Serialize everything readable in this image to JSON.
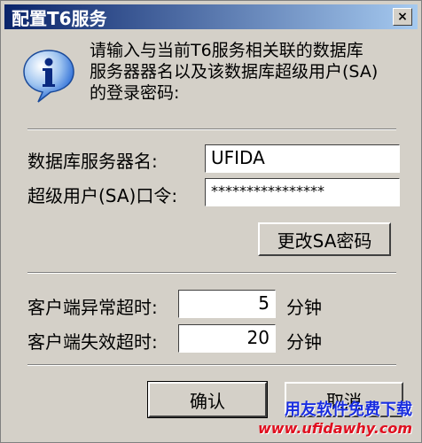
{
  "window": {
    "title": "配置T6服务",
    "close_glyph": "×"
  },
  "description": {
    "line1": "请输入与当前T6服务相关联的数据库",
    "line2": "服务器器名以及该数据库超级用户(SA)",
    "line3": "的登录密码:"
  },
  "db_server": {
    "label": "数据库服务器名:",
    "value": "UFIDA"
  },
  "sa_password": {
    "label": "超级用户(SA)口令:",
    "value": "****************"
  },
  "change_sa_button": "更改SA密码",
  "timeouts": {
    "exception_label": "客户端异常超时:",
    "exception_value": "5",
    "exception_unit": "分钟",
    "invalid_label": "客户端失效超时:",
    "invalid_value": "20",
    "invalid_unit": "分钟"
  },
  "buttons": {
    "ok": "确认",
    "cancel": "取消"
  },
  "watermark": {
    "cn": "用友软件免费下载",
    "url": "www.ufidawhy.com"
  },
  "icons": {
    "info": "info-icon",
    "accent": "#2a6bd6"
  }
}
